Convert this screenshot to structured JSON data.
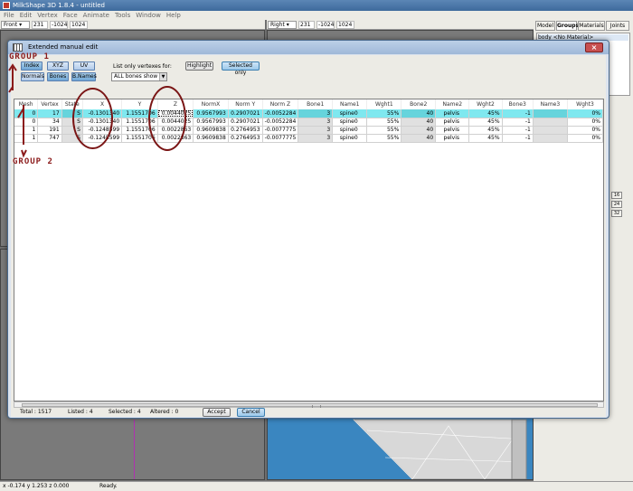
{
  "app": {
    "title": "MilkShape 3D 1.8.4 - untitled",
    "menu": [
      "File",
      "Edit",
      "Vertex",
      "Face",
      "Animate",
      "Tools",
      "Window",
      "Help"
    ]
  },
  "viewports": {
    "front": {
      "name": "Front",
      "v1": "231",
      "v2": "-1024",
      "v3": "1024"
    },
    "right": {
      "name": "Right",
      "v1": "231",
      "v2": "-1024",
      "v3": "1024"
    }
  },
  "right_panel": {
    "tabs": [
      "Model",
      "Groups",
      "Materials",
      "Joints"
    ],
    "active_tab": "Groups",
    "group_item": "body <No Material>",
    "side_buttons": [
      "16",
      "24",
      "32"
    ]
  },
  "statusbar": {
    "coords": "x -0.174 y 1.253 z 0.000",
    "status": "Ready."
  },
  "dialog": {
    "title": "Extended manual edit",
    "toggles": {
      "index": "Index",
      "xyz": "XYZ",
      "uv": "UV",
      "normals": "Normals",
      "bones": "Bones",
      "bnames": "B.Names"
    },
    "list_label": "List only vertexes for:",
    "bone_select": "ALL bones show",
    "highlight": "Highlight",
    "selected_only": "Selected only",
    "columns": [
      "Mesh",
      "Vertex",
      "State",
      "X",
      "Y",
      "Z",
      "NormX",
      "Norm Y",
      "Norm Z",
      "Bone1",
      "Name1",
      "Wght1",
      "Bone2",
      "Name2",
      "Wght2",
      "Bone3",
      "Name3",
      "Wght3"
    ],
    "rows": [
      [
        "0",
        "17",
        "S",
        "-0.1301340",
        "1.1551706",
        "0.0044025",
        "0.9567993",
        "0.2907021",
        "-0.0052284",
        "3",
        "spine0",
        "55%",
        "40",
        "pelvis",
        "45%",
        "-1",
        "",
        "0%"
      ],
      [
        "0",
        "34",
        "S",
        "-0.1301340",
        "1.1551706",
        "0.0044025",
        "0.9567993",
        "0.2907021",
        "-0.0052284",
        "3",
        "spine0",
        "55%",
        "40",
        "pelvis",
        "45%",
        "-1",
        "",
        "0%"
      ],
      [
        "1",
        "191",
        "S",
        "-0.1248599",
        "1.1551706",
        "0.0022863",
        "0.9609838",
        "0.2764953",
        "-0.0077775",
        "3",
        "spine0",
        "55%",
        "40",
        "pelvis",
        "45%",
        "-1",
        "",
        "0%"
      ],
      [
        "1",
        "747",
        "S",
        "-0.1248599",
        "1.1551706",
        "0.0022863",
        "0.9609838",
        "0.2764953",
        "-0.0077775",
        "3",
        "spine0",
        "55%",
        "40",
        "pelvis",
        "45%",
        "-1",
        "",
        "0%"
      ]
    ],
    "footer": {
      "total": "Total : 1517",
      "listed": "Listed : 4",
      "selected": "Selected : 4",
      "altered": "Altered : 0",
      "accept": "Accept",
      "cancel": "Cancel"
    }
  },
  "annotations": {
    "group1": "GROUP 1",
    "group2": "GROUP 2"
  }
}
